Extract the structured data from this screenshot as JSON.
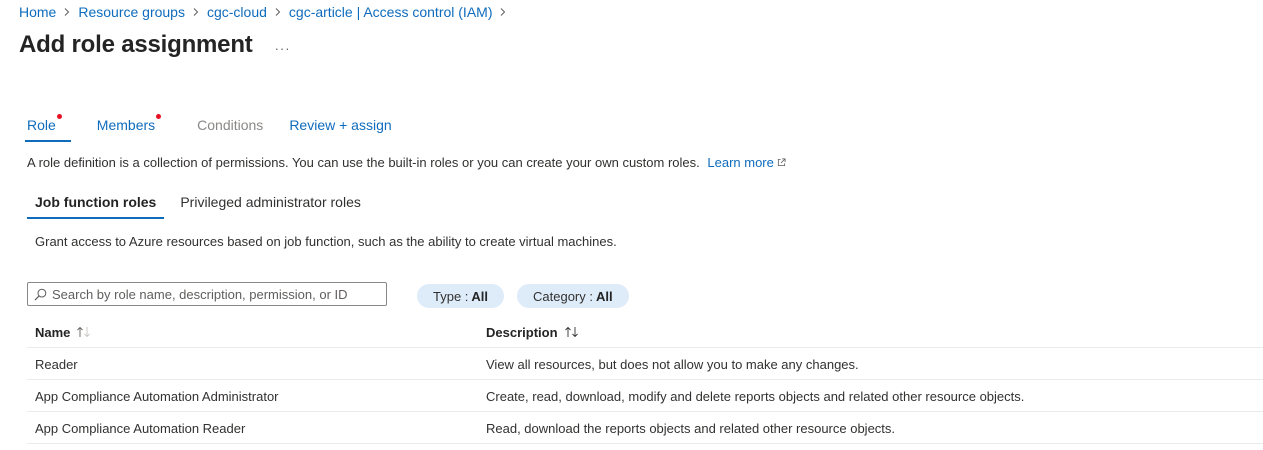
{
  "breadcrumb": {
    "items": [
      "Home",
      "Resource groups",
      "cgc-cloud",
      "cgc-article | Access control (IAM)"
    ]
  },
  "page": {
    "title": "Add role assignment",
    "more_label": "···"
  },
  "wizard_tabs": [
    {
      "label": "Role",
      "state": "active",
      "required": true
    },
    {
      "label": "Members",
      "state": "link",
      "required": true
    },
    {
      "label": "Conditions",
      "state": "disabled",
      "required": false
    },
    {
      "label": "Review + assign",
      "state": "link",
      "required": false
    }
  ],
  "intro": {
    "text": "A role definition is a collection of permissions. You can use the built-in roles or you can create your own custom roles.",
    "learn_more": "Learn more"
  },
  "role_tabs": [
    {
      "label": "Job function roles",
      "active": true
    },
    {
      "label": "Privileged administrator roles",
      "active": false
    }
  ],
  "role_description": "Grant access to Azure resources based on job function, such as the ability to create virtual machines.",
  "search": {
    "placeholder": "Search by role name, description, permission, or ID",
    "value": ""
  },
  "filters": {
    "type": {
      "label": "Type :",
      "value": "All"
    },
    "category": {
      "label": "Category :",
      "value": "All"
    }
  },
  "table": {
    "columns": [
      "Name",
      "Description"
    ],
    "rows": [
      {
        "name": "Reader",
        "description": "View all resources, but does not allow you to make any changes."
      },
      {
        "name": "App Compliance Automation Administrator",
        "description": "Create, read, download, modify and delete reports objects and related other resource objects."
      },
      {
        "name": "App Compliance Automation Reader",
        "description": "Read, download the reports objects and related other resource objects."
      }
    ]
  },
  "colors": {
    "link": "#0f6cbd",
    "required_dot": "#e81123",
    "pill_bg": "#deecf9",
    "disabled": "#8a8886"
  },
  "icons": {
    "breadcrumb_separator": "chevron-right-icon",
    "learn_more": "external-link-icon",
    "search": "search-icon",
    "sort": "sort-arrows-icon"
  }
}
